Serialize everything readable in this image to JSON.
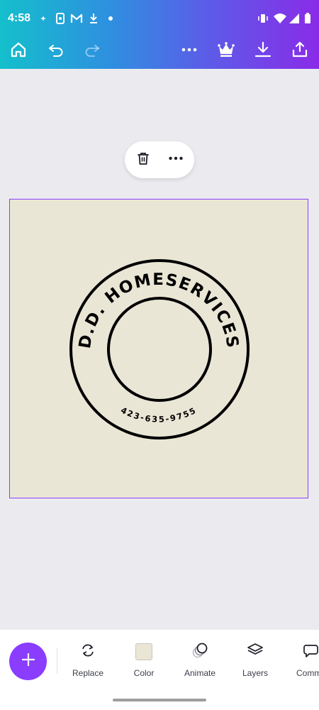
{
  "status_bar": {
    "time": "4:58",
    "left_icons": [
      "sparkle-icon",
      "phone-app-icon",
      "gmail-icon",
      "download-icon",
      "dot-icon"
    ],
    "right_icons": [
      "vibrate-icon",
      "wifi-icon",
      "cell-signal-icon",
      "battery-icon"
    ]
  },
  "toolbar": {
    "icons": [
      "home-icon",
      "undo-icon",
      "redo-icon",
      "more-icon",
      "crown-icon",
      "download-icon",
      "share-icon"
    ]
  },
  "context_menu": {
    "icons": [
      "trash-icon",
      "more-icon"
    ]
  },
  "design": {
    "background_color": "#eae6d6",
    "selection_color": "#8b3dff",
    "title_text": "D.D. HOMESERVICES",
    "phone_text": "423-635-9755"
  },
  "bottom_bar": {
    "add_label": "+",
    "tools": [
      {
        "label": "Replace",
        "icon": "replace-icon"
      },
      {
        "label": "Color",
        "icon": "color-swatch"
      },
      {
        "label": "Animate",
        "icon": "animate-icon"
      },
      {
        "label": "Layers",
        "icon": "layers-icon"
      },
      {
        "label": "Comme",
        "icon": "comment-icon"
      }
    ]
  },
  "accent_color": "#8b3dff"
}
